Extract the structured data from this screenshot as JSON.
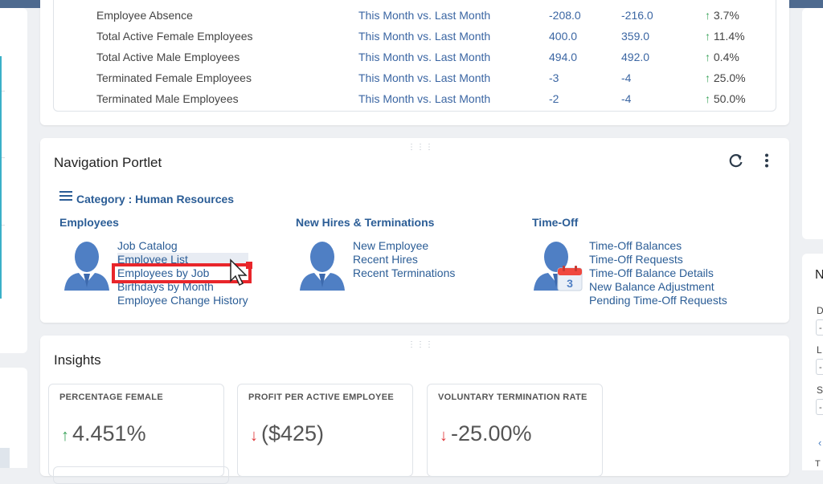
{
  "metrics": {
    "rows": [
      {
        "name": "Employee Absence",
        "period": "This Month vs. Last Month",
        "current": "-208.0",
        "previous": "-216.0",
        "change": "3.7%",
        "direction": "up"
      },
      {
        "name": "Total Active Female Employees",
        "period": "This Month vs. Last Month",
        "current": "400.0",
        "previous": "359.0",
        "change": "11.4%",
        "direction": "up"
      },
      {
        "name": "Total Active Male Employees",
        "period": "This Month vs. Last Month",
        "current": "494.0",
        "previous": "492.0",
        "change": "0.4%",
        "direction": "up"
      },
      {
        "name": "Terminated Female Employees",
        "period": "This Month vs. Last Month",
        "current": "-3",
        "previous": "-4",
        "change": "25.0%",
        "direction": "up"
      },
      {
        "name": "Terminated Male Employees",
        "period": "This Month vs. Last Month",
        "current": "-2",
        "previous": "-4",
        "change": "50.0%",
        "direction": "up"
      }
    ]
  },
  "nav": {
    "title": "Navigation Portlet",
    "category": "Category : Human Resources",
    "refresh_icon": "refresh-icon",
    "more_icon": "more-vertical-icon",
    "sections": [
      {
        "title": "Employees",
        "links": [
          "Job Catalog",
          "Employee List",
          "Employees by Job",
          "Birthdays by Month",
          "Employee Change History"
        ]
      },
      {
        "title": "New Hires & Terminations",
        "links": [
          "New Employee",
          "Recent Hires",
          "Recent Terminations"
        ]
      },
      {
        "title": "Time-Off",
        "links": [
          "Time-Off Balances",
          "Time-Off Requests",
          "Time-Off Balance Details",
          "New Balance Adjustment",
          "Pending Time-Off Requests"
        ]
      }
    ],
    "calendar_day": "3"
  },
  "insights": {
    "title": "Insights",
    "cards": [
      {
        "label": "PERCENTAGE FEMALE",
        "value": "4.451%",
        "direction": "up"
      },
      {
        "label": "PROFIT PER ACTIVE EMPLOYEE",
        "value": "($425)",
        "direction": "down"
      },
      {
        "label": "VOLUNTARY TERMINATION RATE",
        "value": "-25.00%",
        "direction": "down"
      }
    ]
  },
  "right_panel": {
    "title": "N",
    "labels": [
      "D",
      "L",
      "S"
    ],
    "inputs": [
      "-",
      "-",
      "-"
    ],
    "footer": "T"
  },
  "colors": {
    "accent": "#2b5d96",
    "up": "#3aa35a",
    "down": "#e0383b",
    "highlight": "#e8262b"
  }
}
